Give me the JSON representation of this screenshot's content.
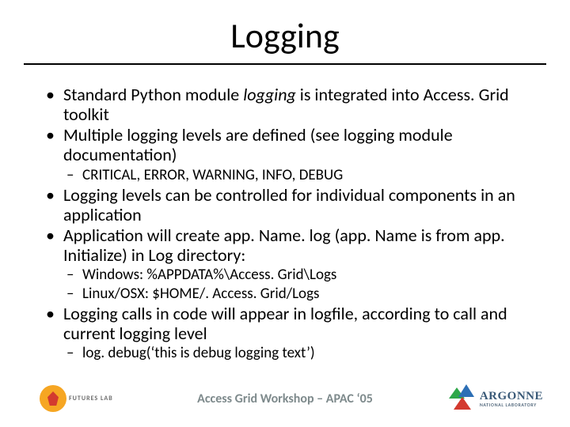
{
  "title": "Logging",
  "bullets": [
    {
      "text_parts": [
        "Standard Python module ",
        "logging",
        " is integrated into Access. Grid toolkit"
      ],
      "italic_index": 1
    },
    {
      "text": "Multiple logging levels are defined (see logging module documentation)",
      "sub": [
        "CRITICAL, ERROR, WARNING, INFO, DEBUG"
      ]
    },
    {
      "text": "Logging levels can be controlled for individual components in an application"
    },
    {
      "text": "Application will create app. Name. log (app. Name is from app. Initialize) in Log directory:",
      "sub": [
        "Windows: %APPDATA%\\Access. Grid\\Logs",
        "Linux/OSX: $HOME/. Access. Grid/Logs"
      ]
    },
    {
      "text": "Logging calls in code will appear in logfile, according to call and current logging level",
      "sub": [
        "log. debug(‘this is debug logging text’)"
      ]
    }
  ],
  "footer": {
    "text": "Access Grid Workshop – APAC ‘05",
    "left_logo_label": "FUTURES LAB",
    "right_logo_main": "ARGONNE",
    "right_logo_sub": "NATIONAL LABORATORY"
  }
}
